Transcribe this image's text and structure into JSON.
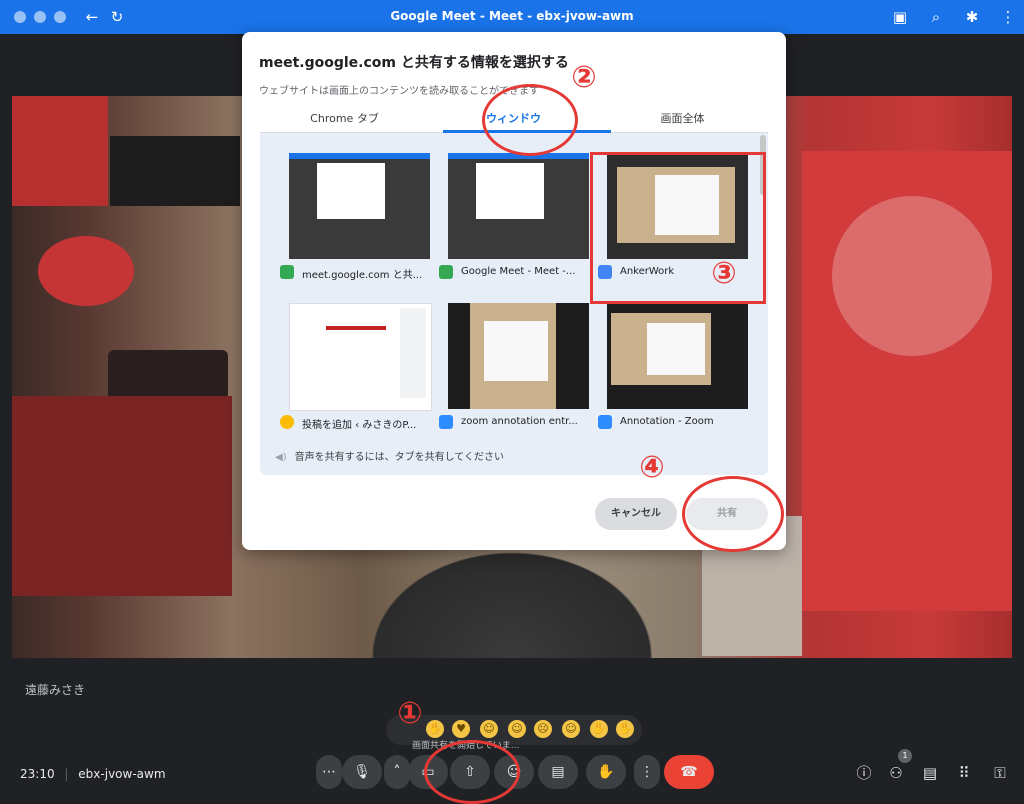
{
  "window": {
    "title": "Google Meet - Meet - ebx-jvow-awm"
  },
  "icons": {
    "back": "arrow-left-icon",
    "reload": "reload-icon",
    "camera": "video-camera-icon",
    "zoom": "zoom-icon",
    "extension": "puzzle-icon",
    "more": "more-vert-icon"
  },
  "dialog": {
    "title": "meet.google.com と共有する情報を選択する",
    "subtitle": "ウェブサイトは画面上のコンテンツを読み取ることができます",
    "tabs": [
      "Chrome タブ",
      "ウィンドウ",
      "画面全体"
    ],
    "active_tab": 1,
    "items": [
      {
        "label": "meet.google.com と共...",
        "app_icon": "meet-icon"
      },
      {
        "label": "Google Meet - Meet -...",
        "app_icon": "meet-icon"
      },
      {
        "label": "AnkerWork",
        "app_icon": "ankerwork-icon"
      },
      {
        "label": "投稿を追加 ‹ みさきのP...",
        "app_icon": "chrome-icon"
      },
      {
        "label": "zoom annotation entr...",
        "app_icon": "zoom-icon"
      },
      {
        "label": "Annotation - Zoom",
        "app_icon": "zoom-icon"
      }
    ],
    "audio_note": "音声を共有するには、タブを共有してください",
    "cancel": "キャンセル",
    "share": "共有"
  },
  "annotations": {
    "n1": "①",
    "n2": "②",
    "n3": "③",
    "n4": "④"
  },
  "meet": {
    "speaker_name": "遠藤みさき",
    "tooltip": "画面共有を開始していま...",
    "time": "23:10",
    "divider": "|",
    "meeting_code": "ebx-jvow-awm",
    "participants_badge": "1"
  },
  "colors": {
    "accent": "#1a73e8",
    "annotation": "#e53935",
    "hangup": "#ea4335"
  }
}
